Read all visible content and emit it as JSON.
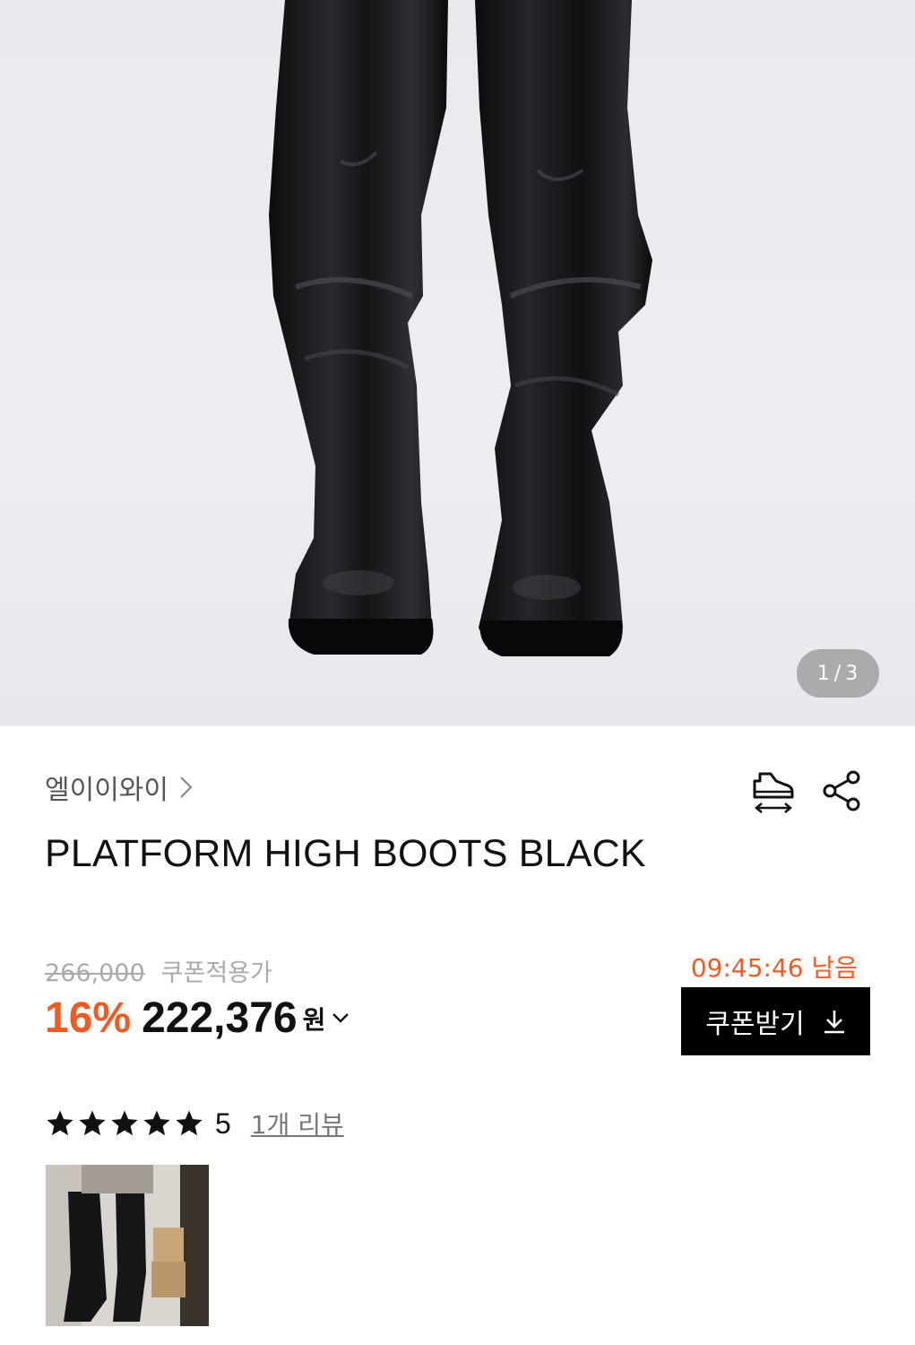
{
  "gallery": {
    "current": "1",
    "separator": "/",
    "total": "3"
  },
  "product": {
    "brand": "엘이이와이",
    "title": "PLATFORM HIGH BOOTS BLACK"
  },
  "pricing": {
    "original_price": "266,000",
    "coupon_label": "쿠폰적용가",
    "discount": "16%",
    "price": "222,376",
    "currency": "원",
    "timer": "09:45:46 남음",
    "coupon_button": "쿠폰받기",
    "accent_color": "#f25a22"
  },
  "reviews": {
    "stars": 5,
    "rating": "5",
    "link": "1개 리뷰"
  },
  "icons": {
    "size_guide": "shoe-size-icon",
    "share": "share-icon",
    "download": "download-icon"
  }
}
